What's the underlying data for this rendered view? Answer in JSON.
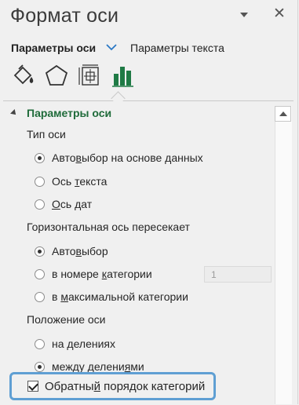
{
  "header": {
    "title": "Формат оси"
  },
  "tabs": {
    "active_label": "Параметры оси",
    "other_label": "Параметры текста"
  },
  "section": {
    "title": "Параметры оси",
    "axis_type": {
      "label": "Тип оси",
      "options": [
        {
          "pre": "Авто",
          "u": "в",
          "post": "ыбор на основе данных",
          "checked": true
        },
        {
          "pre": "Ось ",
          "u": "т",
          "post": "екста",
          "checked": false
        },
        {
          "pre": "",
          "u": "О",
          "post": "сь дат",
          "checked": false
        }
      ]
    },
    "horizontal_cross": {
      "label": "Горизонтальная ось пересекает",
      "options": [
        {
          "pre": "Авто",
          "u": "в",
          "post": "ыбор",
          "checked": true
        },
        {
          "pre": "в номере ",
          "u": "к",
          "post": "атегории",
          "checked": false
        },
        {
          "pre": "в ",
          "u": "м",
          "post": "аксимальной категории",
          "checked": false
        }
      ],
      "category_number_value": "1"
    },
    "axis_position": {
      "label": "Положение оси",
      "options": [
        {
          "pre": "на ",
          "u": "д",
          "post": "елениях",
          "checked": false
        },
        {
          "pre": "между делени",
          "u": "я",
          "post": "ми",
          "checked": true
        }
      ]
    },
    "reverse_order": {
      "pre": "Обратны",
      "u": "й",
      "post": " порядок категорий",
      "checked": true
    }
  },
  "colors": {
    "section_title": "#1f6b3a",
    "chart_icon": "#1f7a45",
    "highlight": "#5f9fd3"
  },
  "icons": [
    "fill-line-icon",
    "effects-pentagon-icon",
    "size-properties-icon",
    "axis-options-bar-chart-icon"
  ]
}
